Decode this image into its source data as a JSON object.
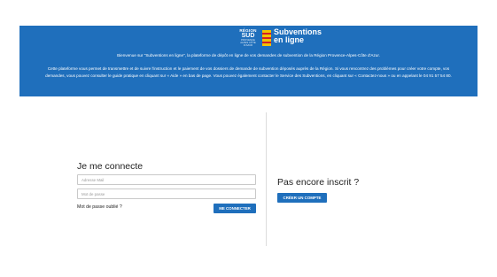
{
  "banner": {
    "region_line1": "RÉGION",
    "region_line2": "SUD",
    "region_small": "PROVENCE ALPES CÔTE D'AZUR",
    "brand_line1": "Subventions",
    "brand_line2": "en ligne",
    "welcome": "Bienvenue sur \"Subventions en ligne\", la plateforme de dépôt en ligne de vos demandes de subvention de la Région Provence-Alpes-Côte d'Azur.",
    "description": "Cette plateforme vous permet de transmettre et de suivre l'instruction et le paiement de vos dossiers de demande de subvention déposés auprès de la Région. Si vous rencontrez des problèmes pour créer votre compte, vos demandes, vous pouvez consulter le guide pratique en cliquant sur « Aide » en bas de page. Vous pouvez également contacter le Service des Subventions, en cliquant sur « Contactez-nous » ou en appelant le 04 91 57 54 80.",
    "color": "#1f6fbc"
  },
  "login": {
    "title": "Je me connecte",
    "email_placeholder": "Adresse Mail",
    "email_value": "",
    "password_placeholder": "Mot de passe",
    "password_value": "",
    "forgot_label": "Mot de passe oublié ?",
    "submit_label": "ME CONNECTER"
  },
  "signup": {
    "title": "Pas encore inscrit ?",
    "create_label": "CRÉER UN COMPTE"
  }
}
